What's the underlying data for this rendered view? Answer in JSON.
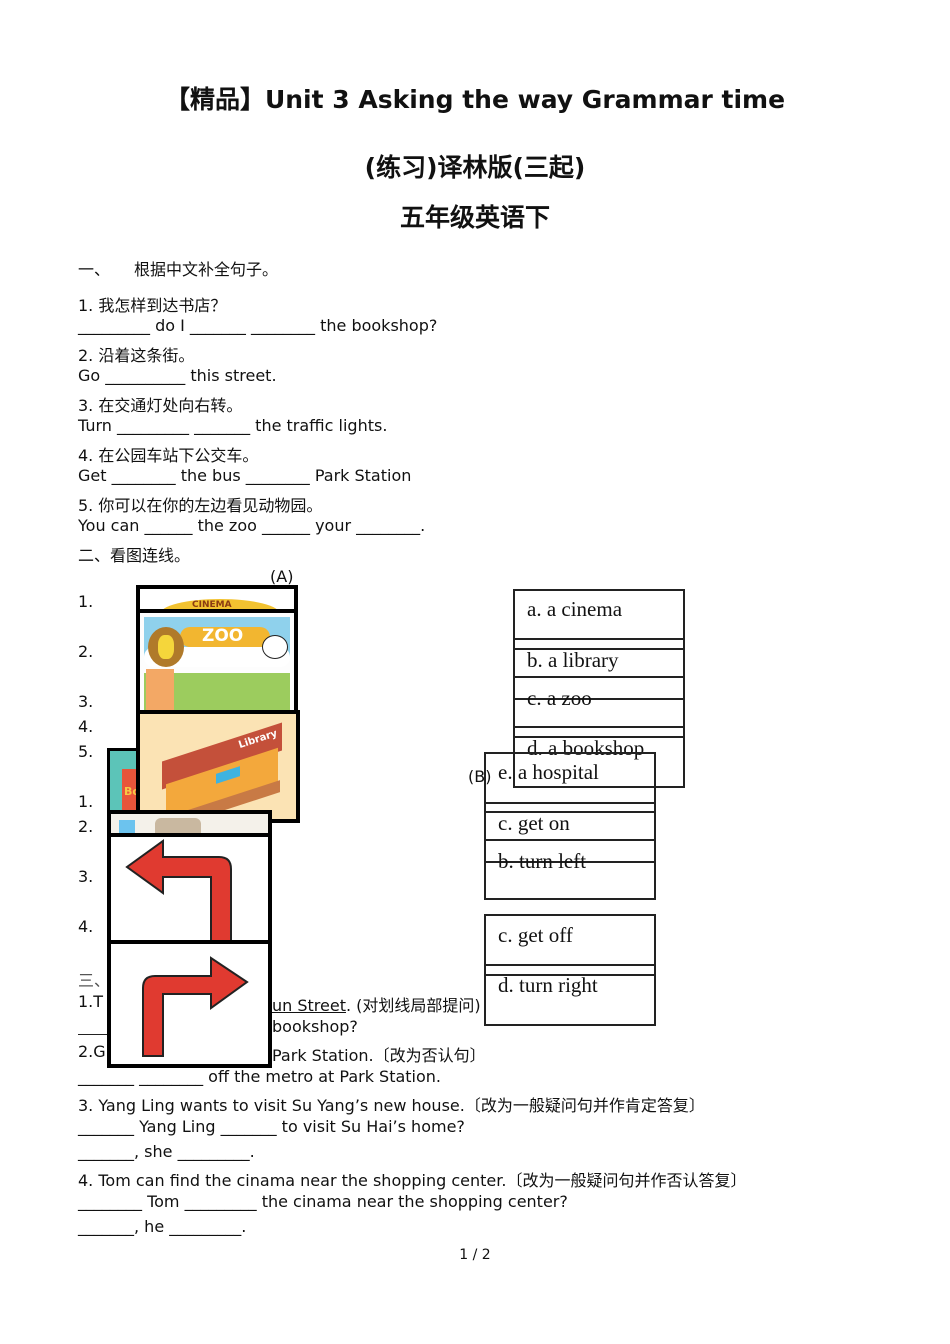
{
  "title": {
    "line1": "【精品】Unit 3 Asking the way Grammar time",
    "line2": "(练习)译林版(三起)",
    "line3": "五年级英语下"
  },
  "section1": {
    "heading_num": "一、",
    "heading": "根据中文补全句子。",
    "items": [
      {
        "zh": "1. 我怎样到达书店？",
        "en": "_________ do I _______  ________ the bookshop?"
      },
      {
        "zh": "2. 沿着这条街。",
        "en": "Go __________ this street."
      },
      {
        "zh": "3. 在交通灯处向右转。",
        "en": "Turn _________ _______ the traffic lights."
      },
      {
        "zh": "4. 在公园车站下公交车。",
        "en": "Get ________ the bus ________ Park Station"
      },
      {
        "zh": "5. 你可以在你的左边看见动物园。",
        "en": "You can ______ the zoo ______ your ________."
      }
    ]
  },
  "section2": {
    "heading": "二、看图连线。",
    "part_a_label": "(A)",
    "part_b_label": "(B)",
    "part_a_numbers": [
      "1.",
      "2.",
      "3.",
      "4.",
      "5."
    ],
    "part_b_numbers": [
      "1.",
      "2.",
      "3.",
      "4."
    ],
    "images": {
      "cinema_sign": "CINEMA",
      "zoo_sign": "ZOO",
      "library_sign": "Library",
      "bookshop_sign": "Bo"
    },
    "part_a_options": [
      "a. a cinema",
      "b. a library",
      "c. a zoo",
      "d. a bookshop",
      "e. a hospital"
    ],
    "part_b_options": [
      "c. get on",
      "b. turn left",
      "c. get off",
      "d. turn right"
    ]
  },
  "section3": {
    "heading": "三、",
    "items": [
      {
        "q_start": "1.T",
        "q_underlined": "un Street",
        "q_end": ". (对划线局部提问)",
        "answer": "bookshop?"
      },
      {
        "q_start": "2.G",
        "q_end": "Park Station.〔改为否认句〕",
        "answer": "_______ ________ off the metro at Park Station."
      },
      {
        "q": "3. Yang Ling wants to visit Su Yang’s new house.〔改为一般疑问句并作肯定答复〕",
        "answer1": "_______ Yang Ling _______ to visit Su Hai’s home?",
        "answer2": "_______, she _________."
      },
      {
        "q": "4. Tom can find the cinama near the shopping center.〔改为一般疑问句并作否认答复〕",
        "answer1": "________ Tom _________ the cinama near the shopping center?",
        "answer2": "_______, he _________."
      }
    ]
  },
  "footer": {
    "page": "1 / 2"
  }
}
